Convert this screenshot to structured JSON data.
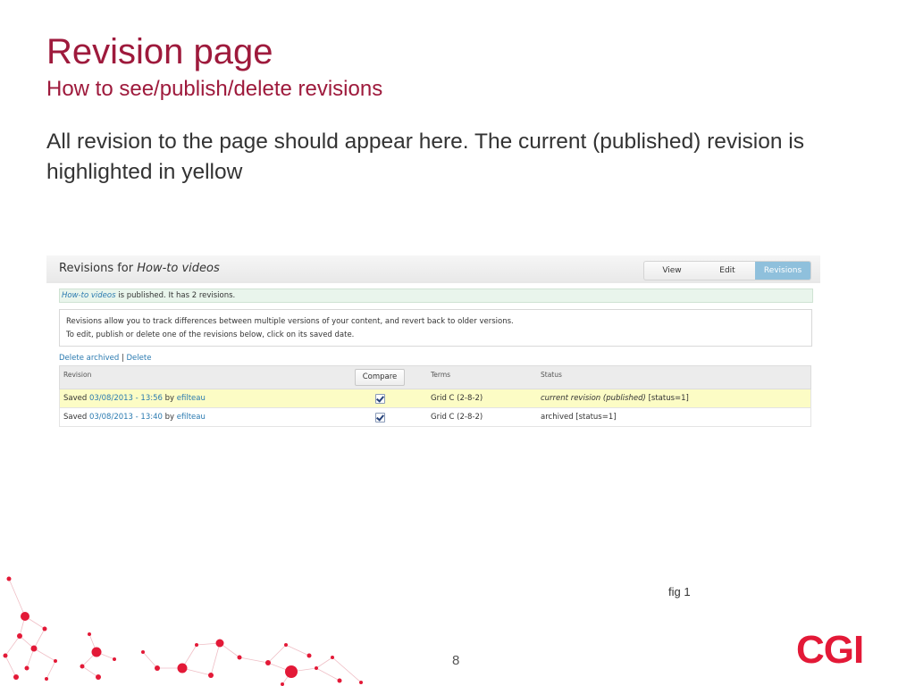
{
  "slide": {
    "title": "Revision page",
    "subtitle": "How to see/publish/delete revisions",
    "body": "All revision to the page should appear here. The current (published) revision is highlighted in yellow",
    "fig_label": "fig 1",
    "page_number": "8",
    "logo_text": "CGI",
    "accent_color": "#9e1a3c",
    "logo_color": "#e31937"
  },
  "screenshot": {
    "header": {
      "title_prefix": "Revisions for ",
      "title_italic": "How-to videos",
      "tabs": [
        {
          "label": "View",
          "active": false
        },
        {
          "label": "Edit",
          "active": false
        },
        {
          "label": "Revisions",
          "active": true
        }
      ]
    },
    "status": {
      "italic": "How-to videos",
      "text": " is published. It has 2 revisions."
    },
    "help": {
      "line1": "Revisions allow you to track differences between multiple versions of your content, and revert back to older versions.",
      "line2": "To edit, publish or delete one of the revisions below, click on its saved date."
    },
    "links": {
      "delete_archived": "Delete archived",
      "separator": "|",
      "delete": "Delete"
    },
    "table": {
      "headers": {
        "revision": "Revision",
        "compare": "Compare",
        "terms": "Terms",
        "status": "Status"
      },
      "rows": [
        {
          "saved": "Saved ",
          "date": "03/08/2013 - 13:56",
          "by": " by ",
          "user": "efilteau",
          "checked": true,
          "terms": "Grid C (2-8-2)",
          "status_italic": "current revision (published)",
          "status_rest": " [status=1]",
          "current": true
        },
        {
          "saved": "Saved ",
          "date": "03/08/2013 - 13:40",
          "by": " by ",
          "user": "efilteau",
          "checked": true,
          "terms": "Grid C (2-8-2)",
          "status_italic": "",
          "status_rest": "archived [status=1]",
          "current": false
        }
      ]
    }
  }
}
